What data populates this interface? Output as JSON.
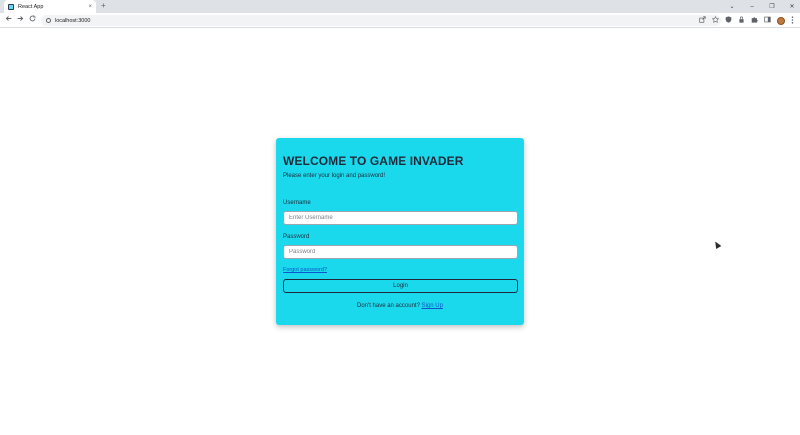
{
  "browser": {
    "tab_title": "React App",
    "tab_close": "×",
    "new_tab": "+",
    "address": "localhost:3000",
    "back_icon": "arrow-left-icon",
    "forward_icon": "arrow-right-icon",
    "reload_icon": "reload-icon",
    "window_controls": {
      "minimize": "–",
      "restore": "❐",
      "close": "✕",
      "tab_search": "⌄"
    }
  },
  "login": {
    "title": "WELCOME TO GAME INVADER",
    "subtitle": "Please enter your login and password!",
    "username_label": "Username",
    "username_placeholder": "Enter Username",
    "password_label": "Password",
    "password_placeholder": "Password",
    "forgot_link": "Forgot password?",
    "login_button": "Login",
    "signup_prompt": "Don't have an account?",
    "signup_link": "Sign Up"
  },
  "colors": {
    "card_background": "#1bd9ec",
    "text": "#1e2a3a",
    "link": "#1155cc"
  }
}
